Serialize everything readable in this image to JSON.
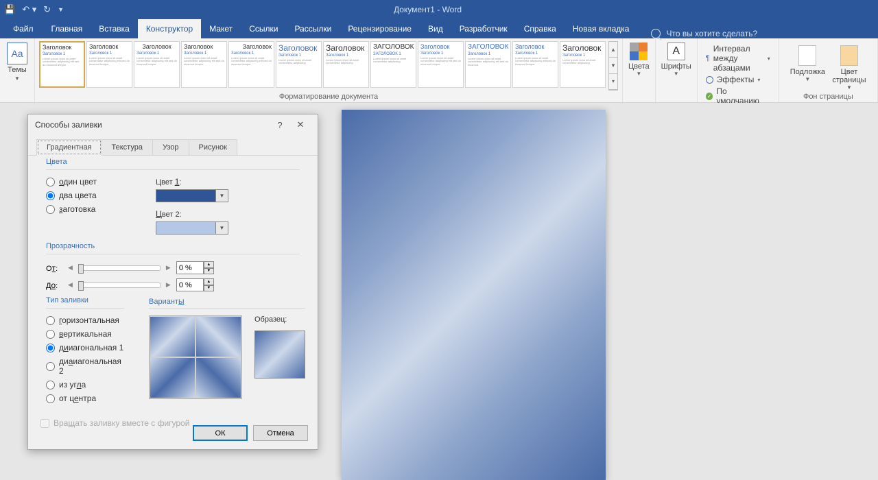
{
  "window": {
    "title": "Документ1 - Word"
  },
  "tabs": {
    "file": "Файл",
    "home": "Главная",
    "insert": "Вставка",
    "design": "Конструктор",
    "layout": "Макет",
    "references": "Ссылки",
    "mailings": "Рассылки",
    "review": "Рецензирование",
    "view": "Вид",
    "developer": "Разработчик",
    "help": "Справка",
    "new": "Новая вкладка",
    "tellme": "Что вы хотите сделать?"
  },
  "ribbon": {
    "themes": "Темы",
    "colors": "Цвета",
    "fonts": "Шрифты",
    "paragraph_spacing": "Интервал между абзацами",
    "effects": "Эффекты",
    "default": "По умолчанию",
    "watermark": "Подложка",
    "page_color": "Цвет страницы",
    "doc_formatting": "Форматирование документа",
    "page_bg": "Фон страницы",
    "style_heading": "Заголовок",
    "style_heading_caps": "ЗАГОЛОВОК",
    "style_heading1": "Заголовок 1"
  },
  "dialog": {
    "title": "Способы заливки",
    "tabs": {
      "gradient": "Градиентная",
      "texture": "Текстура",
      "pattern": "Узор",
      "picture": "Рисунок"
    },
    "colors_legend": "Цвета",
    "one_color": "один цвет",
    "two_colors": "два цвета",
    "preset": "заготовка",
    "color1_label": "Цвет 1:",
    "color2_label": "Цвет 2:",
    "color1_value": "#2f5597",
    "color2_value": "#b4c7e7",
    "transparency_legend": "Прозрачность",
    "from_label": "От:",
    "to_label": "До:",
    "from_value": "0 %",
    "to_value": "0 %",
    "fill_type_legend": "Тип заливки",
    "horizontal": "горизонтальная",
    "vertical": "вертикальная",
    "diag1": "диагональная 1",
    "diag2": "диагональная 2",
    "corner": "из угла",
    "center": "от центра",
    "variants_legend": "Варианты",
    "sample_label": "Образец:",
    "rotate_with_shape": "Вращать заливку вместе с фигурой",
    "ok": "ОК",
    "cancel": "Отмена",
    "colors_selected": "two_colors",
    "fill_type_selected": "diag1"
  }
}
